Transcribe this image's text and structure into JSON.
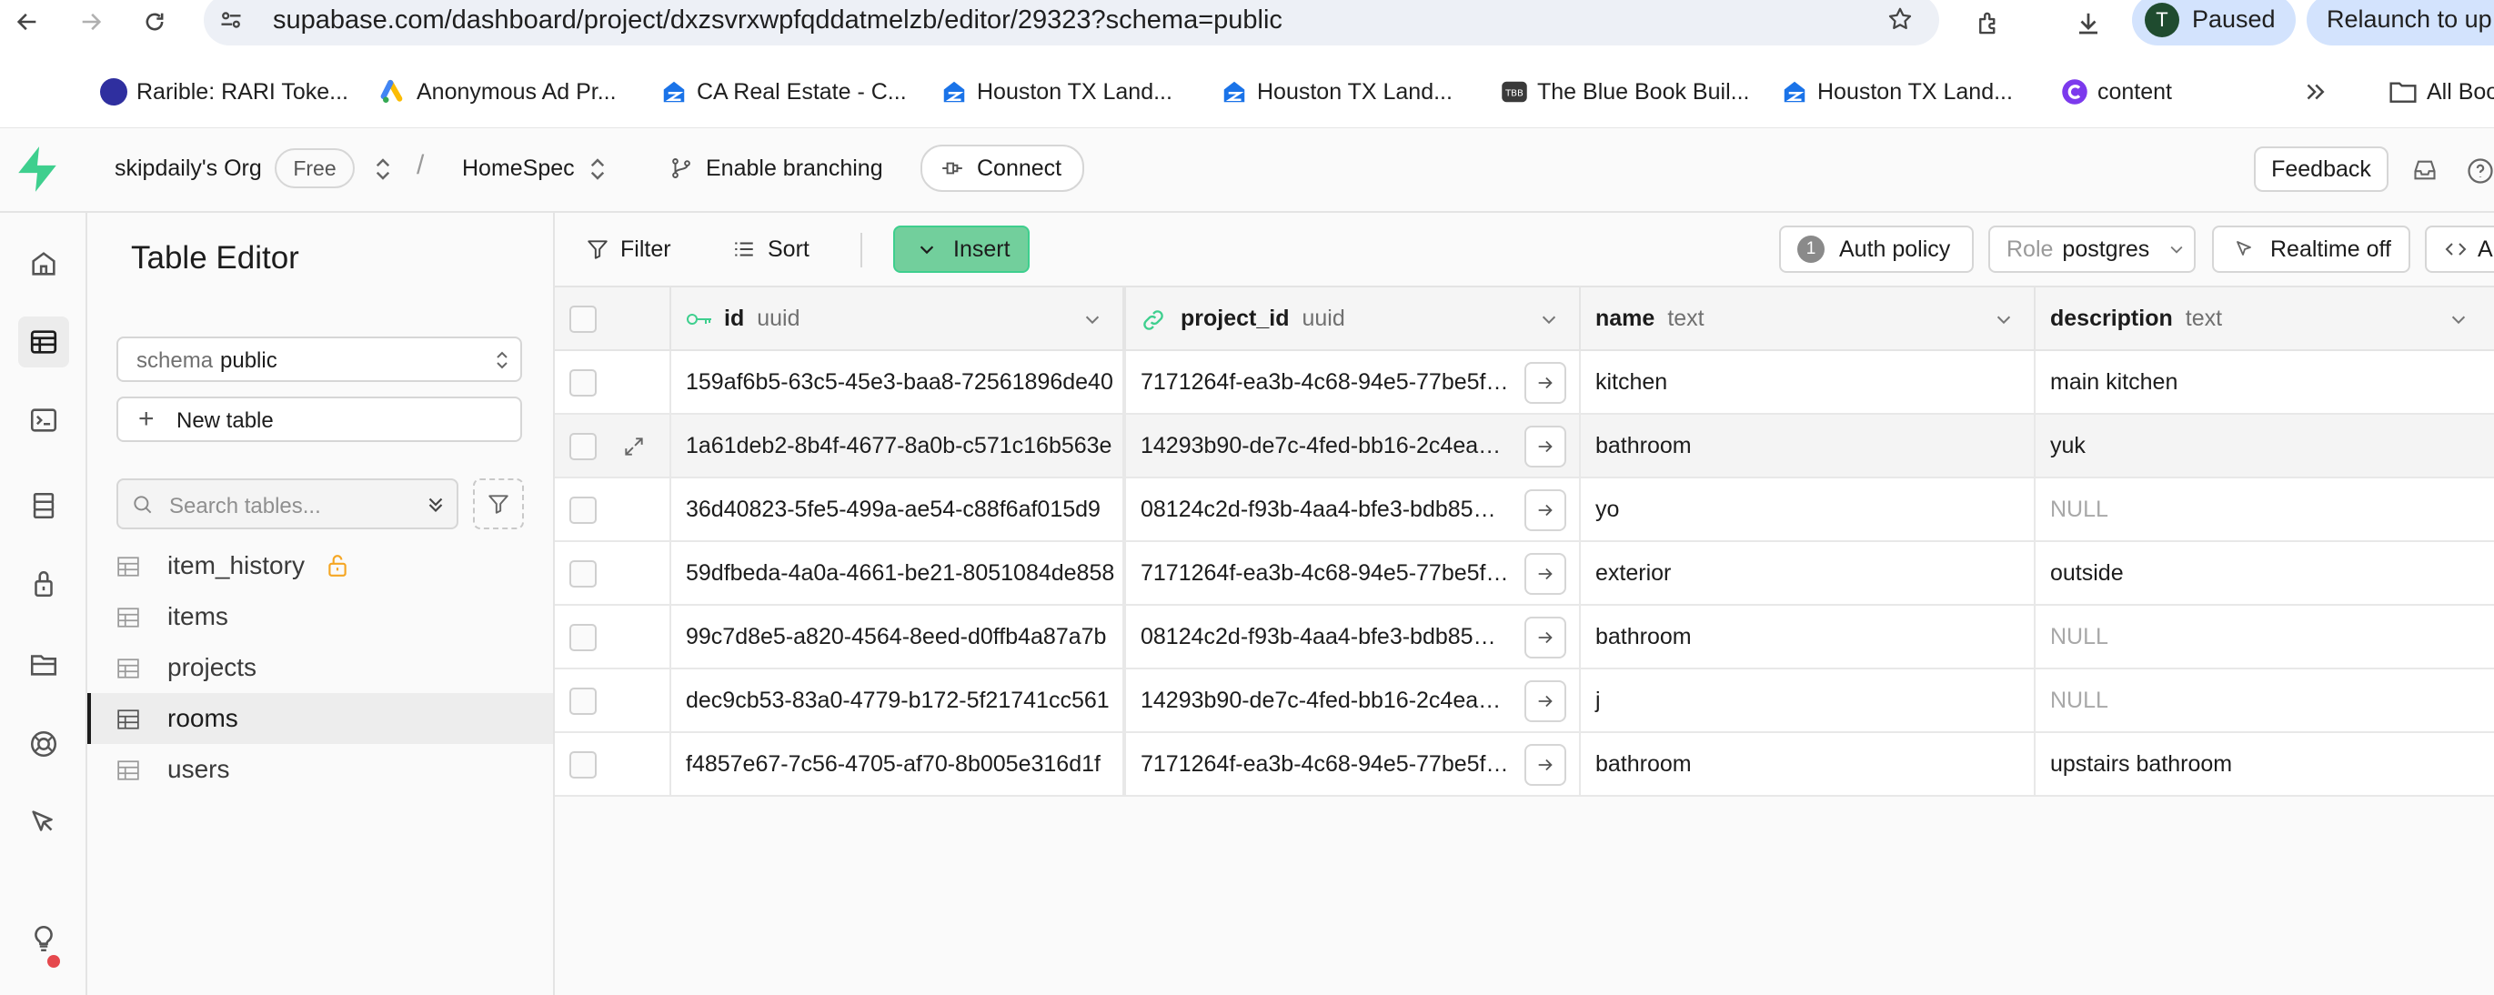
{
  "browser": {
    "url": "supabase.com/dashboard/project/dxzsvrxwpfqddatmelzb/editor/29323?schema=public",
    "profile_initial": "T",
    "profile_status": "Paused",
    "relaunch_label": "Relaunch to up",
    "bookmarks": [
      {
        "label": "Rarible: RARI Toke...",
        "icon": "rarible-icon",
        "color": "#2f2f9f"
      },
      {
        "label": "Anonymous Ad Pr...",
        "icon": "google-ads-icon",
        "color": "#fbbc04"
      },
      {
        "label": "CA Real Estate - C...",
        "icon": "zillow-icon",
        "color": "#1a73e8"
      },
      {
        "label": "Houston TX Land...",
        "icon": "zillow-icon",
        "color": "#1a73e8"
      },
      {
        "label": "Houston TX Land...",
        "icon": "zillow-icon",
        "color": "#1a73e8"
      },
      {
        "label": "The Blue Book Buil...",
        "icon": "tbb-icon",
        "color": "#3a3a3a"
      },
      {
        "label": "Houston TX Land...",
        "icon": "zillow-icon",
        "color": "#1a73e8"
      },
      {
        "label": "content",
        "icon": "c-logo-icon",
        "color": "#7c3aed"
      }
    ],
    "all_bookmarks_label": "All Boo"
  },
  "header": {
    "org": "skipdaily's Org",
    "plan_badge": "Free",
    "project": "HomeSpec",
    "branching_label": "Enable branching",
    "connect_label": "Connect",
    "feedback_label": "Feedback",
    "brand_color": "#3ecf8e"
  },
  "sidebar": {
    "title": "Table Editor",
    "schema_label": "schema",
    "schema_value": "public",
    "new_table_label": "New table",
    "search_placeholder": "Search tables...",
    "tables": [
      {
        "name": "item_history",
        "locked": true,
        "active": false
      },
      {
        "name": "items",
        "locked": false,
        "active": false
      },
      {
        "name": "projects",
        "locked": false,
        "active": false
      },
      {
        "name": "rooms",
        "locked": false,
        "active": true
      },
      {
        "name": "users",
        "locked": false,
        "active": false
      }
    ]
  },
  "toolbar": {
    "filter_label": "Filter",
    "sort_label": "Sort",
    "insert_label": "Insert",
    "auth_policy_count": "1",
    "auth_policy_label": "Auth policy",
    "role_label": "Role",
    "role_value": "postgres",
    "realtime_label": "Realtime off",
    "api_label": "A"
  },
  "grid": {
    "columns": [
      {
        "name": "id",
        "type": "uuid",
        "icon": "key-icon"
      },
      {
        "name": "project_id",
        "type": "uuid",
        "icon": "link-icon"
      },
      {
        "name": "name",
        "type": "text",
        "icon": ""
      },
      {
        "name": "description",
        "type": "text",
        "icon": ""
      }
    ],
    "rows": [
      {
        "id": "159af6b5-63c5-45e3-baa8-72561896de40",
        "project_id": "7171264f-ea3b-4c68-94e5-77be5f…",
        "name": "kitchen",
        "description": "main kitchen"
      },
      {
        "id": "1a61deb2-8b4f-4677-8a0b-c571c16b563e",
        "project_id": "14293b90-de7c-4fed-bb16-2c4ea…",
        "name": "bathroom",
        "description": "yuk"
      },
      {
        "id": "36d40823-5fe5-499a-ae54-c88f6af015d9",
        "project_id": "08124c2d-f93b-4aa4-bfe3-bdb85…",
        "name": "yo",
        "description": "NULL"
      },
      {
        "id": "59dfbeda-4a0a-4661-be21-8051084de858",
        "project_id": "7171264f-ea3b-4c68-94e5-77be5f…",
        "name": "exterior",
        "description": "outside"
      },
      {
        "id": "99c7d8e5-a820-4564-8eed-d0ffb4a87a7b",
        "project_id": "08124c2d-f93b-4aa4-bfe3-bdb85…",
        "name": "bathroom",
        "description": "NULL"
      },
      {
        "id": "dec9cb53-83a0-4779-b172-5f21741cc561",
        "project_id": "14293b90-de7c-4fed-bb16-2c4ea…",
        "name": "j",
        "description": "NULL"
      },
      {
        "id": "f4857e67-7c56-4705-af70-8b005e316d1f",
        "project_id": "7171264f-ea3b-4c68-94e5-77be5f…",
        "name": "bathroom",
        "description": "upstairs bathroom"
      }
    ]
  }
}
